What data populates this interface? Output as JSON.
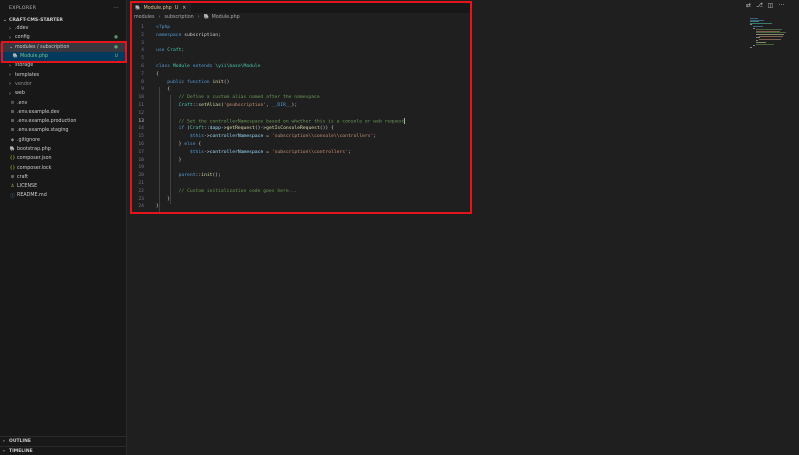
{
  "explorer": {
    "title": "EXPLORER",
    "more": "···",
    "project": "CRAFT-CMS-STARTER",
    "tree": [
      {
        "label": ".ddev",
        "kind": "folder",
        "chevron": "›",
        "badge": ""
      },
      {
        "label": "config",
        "kind": "folder",
        "chevron": "›",
        "badge": "●"
      },
      {
        "label": "modules / subscription",
        "kind": "folder-open",
        "chevron": "⌄",
        "badge": "●"
      },
      {
        "label": "Module.php",
        "kind": "php",
        "chevron": "",
        "badge": "U"
      },
      {
        "label": "storage",
        "kind": "folder",
        "chevron": "›",
        "badge": ""
      },
      {
        "label": "templates",
        "kind": "folder",
        "chevron": "›",
        "badge": ""
      },
      {
        "label": "vendor",
        "kind": "folder",
        "chevron": "›",
        "badge": ""
      },
      {
        "label": "web",
        "kind": "folder",
        "chevron": "›",
        "badge": ""
      },
      {
        "label": ".env",
        "kind": "gear",
        "chevron": "",
        "badge": ""
      },
      {
        "label": ".env.example.dev",
        "kind": "lines",
        "chevron": "",
        "badge": ""
      },
      {
        "label": ".env.example.production",
        "kind": "lines",
        "chevron": "",
        "badge": ""
      },
      {
        "label": ".env.example.staging",
        "kind": "lines",
        "chevron": "",
        "badge": ""
      },
      {
        "label": ".gitignore",
        "kind": "git",
        "chevron": "",
        "badge": ""
      },
      {
        "label": "bootstrap.php",
        "kind": "php",
        "chevron": "",
        "badge": ""
      },
      {
        "label": "composer.json",
        "kind": "json",
        "chevron": "",
        "badge": ""
      },
      {
        "label": "composer.lock",
        "kind": "json",
        "chevron": "",
        "badge": ""
      },
      {
        "label": "craft",
        "kind": "lines",
        "chevron": "",
        "badge": ""
      },
      {
        "label": "LICENSE",
        "kind": "license",
        "chevron": "",
        "badge": ""
      },
      {
        "label": "README.md",
        "kind": "info",
        "chevron": "",
        "badge": ""
      }
    ],
    "outline": "OUTLINE",
    "timeline": "TIMELINE"
  },
  "icons": {
    "php": "🐘",
    "gear": "⚙",
    "lines": "≡",
    "git": "◆",
    "json": "{}",
    "license": "♙",
    "info": "ⓘ"
  },
  "editor": {
    "tab": {
      "label": "Module.php",
      "modified": "U",
      "close": "×"
    },
    "breadcrumb": [
      "modules",
      "subscription",
      "Module.php"
    ],
    "current_line": 13,
    "cursor_line": 13
  },
  "code_lines": [
    [
      {
        "t": "<?php",
        "c": "k"
      }
    ],
    [
      {
        "t": "namespace ",
        "c": "k"
      },
      {
        "t": "subscription;",
        "c": "p"
      }
    ],
    [],
    [
      {
        "t": "use ",
        "c": "k"
      },
      {
        "t": "Craft;",
        "c": "t"
      }
    ],
    [],
    [
      {
        "t": "class ",
        "c": "k"
      },
      {
        "t": "Module ",
        "c": "t"
      },
      {
        "t": "extends ",
        "c": "k"
      },
      {
        "t": "\\yii\\base\\Module",
        "c": "t"
      }
    ],
    [
      {
        "t": "{",
        "c": "p"
      }
    ],
    [
      {
        "t": "    "
      },
      {
        "t": "public function ",
        "c": "k"
      },
      {
        "t": "init",
        "c": "f"
      },
      {
        "t": "()",
        "c": "p"
      }
    ],
    [
      {
        "t": "    {",
        "c": "p"
      }
    ],
    [
      {
        "t": "        "
      },
      {
        "t": "// Define a custom alias named after the namespace",
        "c": "c"
      }
    ],
    [
      {
        "t": "        "
      },
      {
        "t": "Craft",
        "c": "t"
      },
      {
        "t": "::",
        "c": "p"
      },
      {
        "t": "setAlias",
        "c": "f"
      },
      {
        "t": "(",
        "c": "p"
      },
      {
        "t": "'@subscription'",
        "c": "s"
      },
      {
        "t": ", ",
        "c": "p"
      },
      {
        "t": "__DIR__",
        "c": "k"
      },
      {
        "t": ");",
        "c": "p"
      }
    ],
    [],
    [
      {
        "t": "        "
      },
      {
        "t": "// Set the controllerNamespace based on whether this is a console or web request",
        "c": "c"
      }
    ],
    [
      {
        "t": "        "
      },
      {
        "t": "if ",
        "c": "k"
      },
      {
        "t": "(",
        "c": "p"
      },
      {
        "t": "Craft",
        "c": "t"
      },
      {
        "t": "::",
        "c": "p"
      },
      {
        "t": "$app",
        "c": "v"
      },
      {
        "t": "->",
        "c": "p"
      },
      {
        "t": "getRequest",
        "c": "f"
      },
      {
        "t": "()->",
        "c": "p"
      },
      {
        "t": "getIsConsoleRequest",
        "c": "f"
      },
      {
        "t": "()) {",
        "c": "p"
      }
    ],
    [
      {
        "t": "            "
      },
      {
        "t": "$this",
        "c": "k"
      },
      {
        "t": "->",
        "c": "p"
      },
      {
        "t": "controllerNamespace",
        "c": "v"
      },
      {
        "t": " = ",
        "c": "p"
      },
      {
        "t": "'subscription\\\\console\\\\controllers'",
        "c": "s"
      },
      {
        "t": ";",
        "c": "p"
      }
    ],
    [
      {
        "t": "        "
      },
      {
        "t": "} ",
        "c": "p"
      },
      {
        "t": "else ",
        "c": "k"
      },
      {
        "t": "{",
        "c": "p"
      }
    ],
    [
      {
        "t": "            "
      },
      {
        "t": "$this",
        "c": "k"
      },
      {
        "t": "->",
        "c": "p"
      },
      {
        "t": "controllerNamespace",
        "c": "v"
      },
      {
        "t": " = ",
        "c": "p"
      },
      {
        "t": "'subscription\\\\controllers'",
        "c": "s"
      },
      {
        "t": ";",
        "c": "p"
      }
    ],
    [
      {
        "t": "        }",
        "c": "p"
      }
    ],
    [],
    [
      {
        "t": "        "
      },
      {
        "t": "parent",
        "c": "k"
      },
      {
        "t": "::",
        "c": "p"
      },
      {
        "t": "init",
        "c": "f"
      },
      {
        "t": "();",
        "c": "p"
      }
    ],
    [],
    [
      {
        "t": "        "
      },
      {
        "t": "// Custom initialization code goes here...",
        "c": "c"
      }
    ],
    [
      {
        "t": "    }",
        "c": "p"
      }
    ],
    [
      {
        "t": "}",
        "c": "p"
      }
    ]
  ],
  "top_actions": [
    "split-compare",
    "source-control",
    "split-editor",
    "more"
  ],
  "top_action_glyphs": [
    "⇄",
    "⎇",
    "◫",
    "···"
  ],
  "colors": {
    "accent_highlight": "#e3141b",
    "untracked": "#73c991",
    "modified": "#e2c08d",
    "php_icon": "#a074c4"
  }
}
